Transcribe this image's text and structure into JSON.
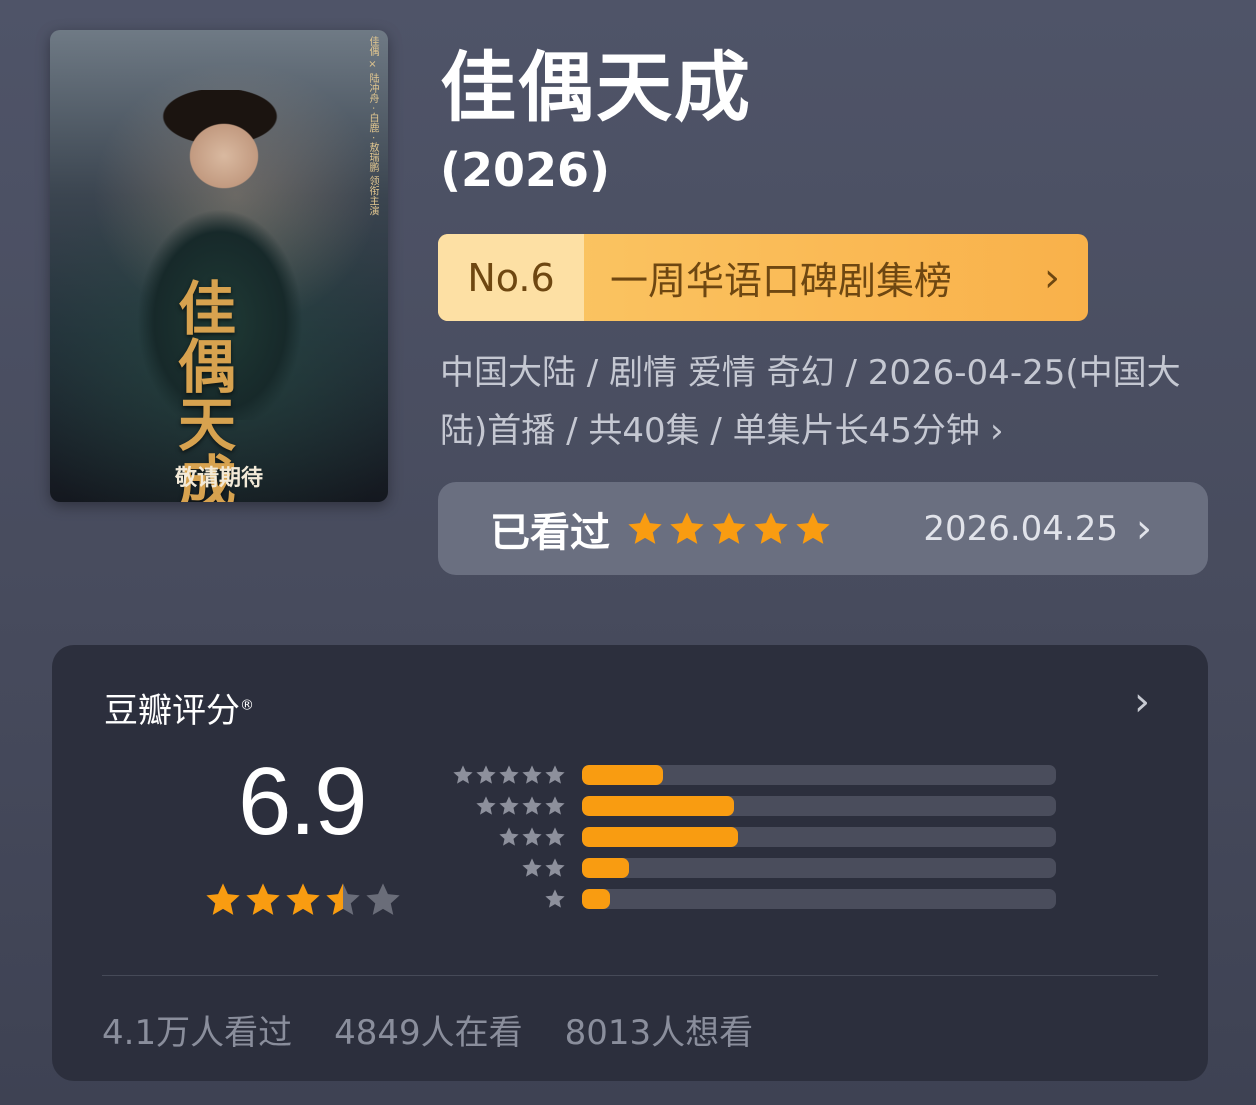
{
  "poster": {
    "calligraphy": "佳偶天成",
    "slogan": "敬请期待",
    "side_text": "佳偶 × 陆冲舟 · 白鹿 · 敖瑞鹏 领衔主演"
  },
  "title": "佳偶天成",
  "year": "(2026)",
  "rank": {
    "number": "No.6",
    "list_name": "一周华语口碑剧集榜",
    "chevron": "›"
  },
  "meta": {
    "text": "中国大陆 / 剧情 爱情 奇幻 / 2026-04-25(中国大陆)首播 / 共40集 / 单集片长45分钟",
    "chevron": "›"
  },
  "watched": {
    "label": "已看过",
    "user_stars": 5,
    "date": "2026.04.25",
    "chevron": "›"
  },
  "rating": {
    "heading": "豆瓣评分",
    "registered_mark": "®",
    "chevron": "›",
    "score": "6.9",
    "score_stars": 3.5,
    "distribution": [
      {
        "stars": 5,
        "fraction": 0.17
      },
      {
        "stars": 4,
        "fraction": 0.32
      },
      {
        "stars": 3,
        "fraction": 0.33
      },
      {
        "stars": 2,
        "fraction": 0.1
      },
      {
        "stars": 1,
        "fraction": 0.06
      }
    ],
    "stats": [
      "4.1万人看过",
      "4849人在看",
      "8013人想看"
    ]
  },
  "colors": {
    "star_active": "#f99c11",
    "star_inactive": "#6a6d79",
    "dist_star": "#8d909c",
    "rank_bg": "#f9b14a"
  }
}
